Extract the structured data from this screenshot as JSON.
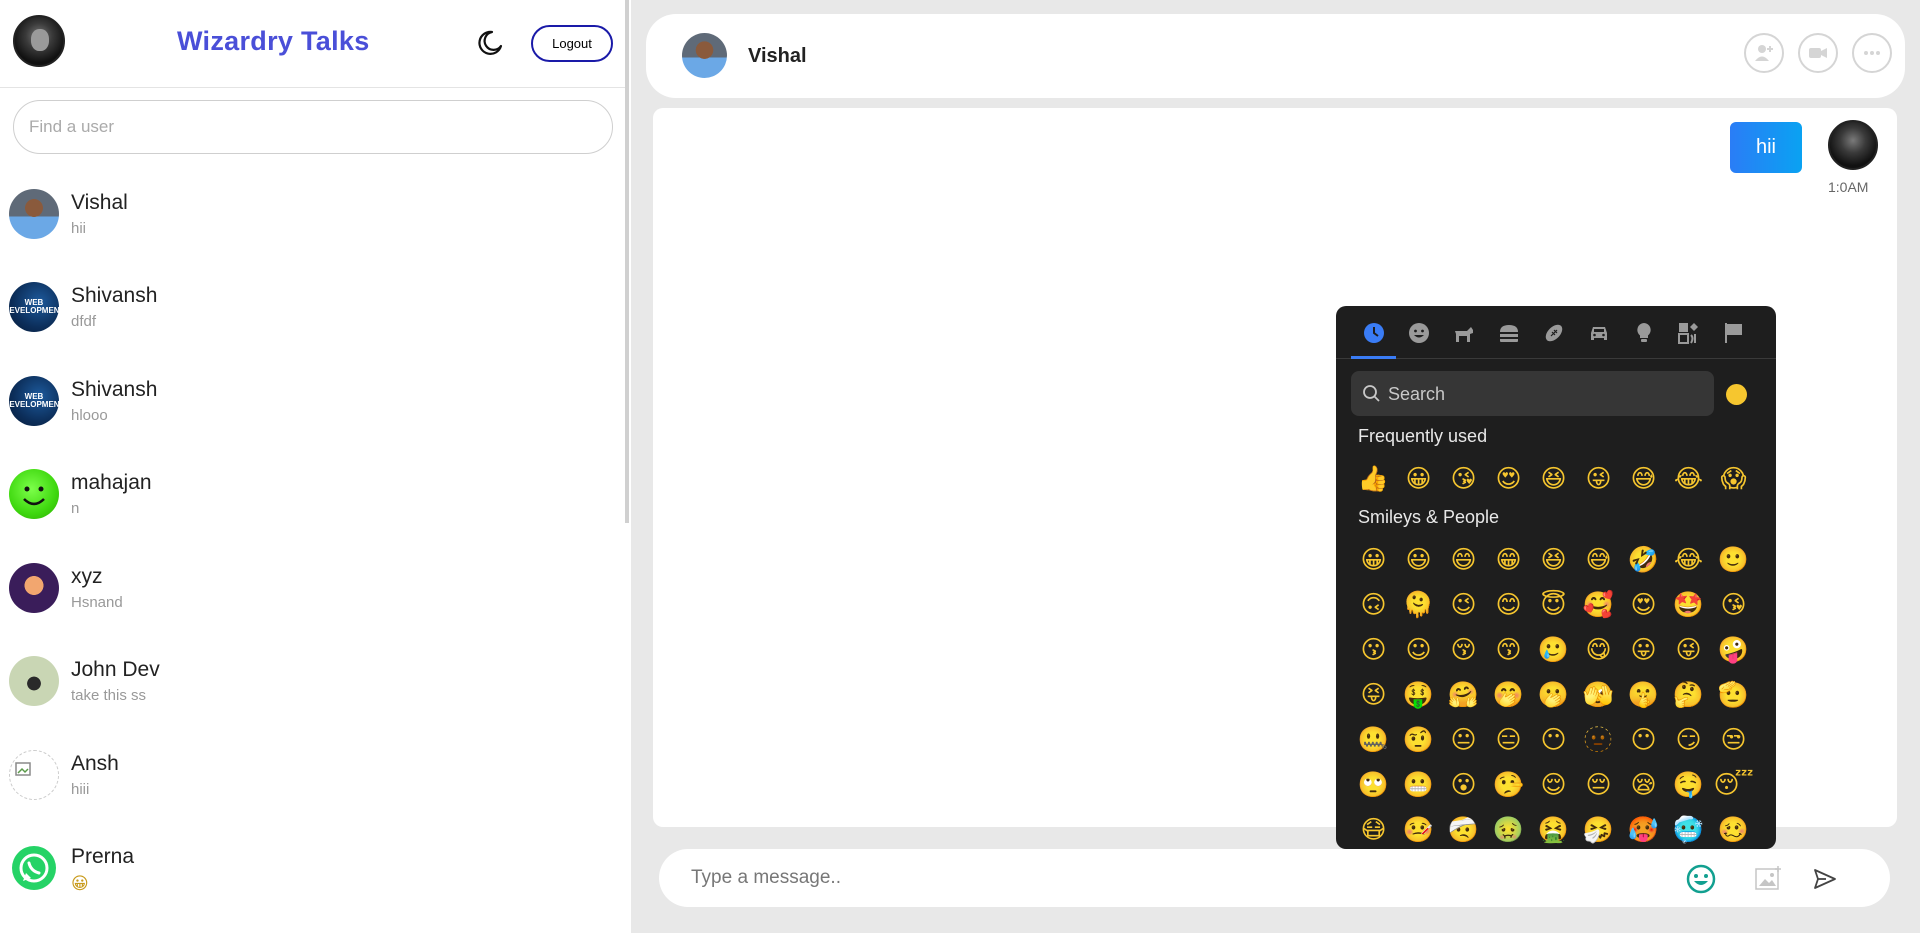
{
  "app": {
    "title": "Wizardry Talks",
    "logout_label": "Logout",
    "search_placeholder": "Find a user"
  },
  "users": [
    {
      "name": "Vishal",
      "last_message": "hii"
    },
    {
      "name": "Shivansh",
      "last_message": "dfdf",
      "avatar_text": "WEB DEVELOPMENT"
    },
    {
      "name": "Shivansh",
      "last_message": "hlooo",
      "avatar_text": "WEB DEVELOPMENT"
    },
    {
      "name": "mahajan",
      "last_message": "n"
    },
    {
      "name": "xyz",
      "last_message": "Hsnand"
    },
    {
      "name": "John Dev",
      "last_message": "take this ss"
    },
    {
      "name": "Ansh",
      "last_message": "hiii"
    },
    {
      "name": "Prerna",
      "last_message": "😀"
    }
  ],
  "chat": {
    "contact_name": "Vishal",
    "messages": [
      {
        "text": "hii",
        "time": "1:0AM",
        "outgoing": true
      }
    ],
    "input_placeholder": "Type a message.."
  },
  "emoji_picker": {
    "search_placeholder": "Search",
    "frequently_used_label": "Frequently used",
    "smileys_label": "Smileys & People",
    "categories": [
      "recent-icon",
      "smiley-icon",
      "animal-icon",
      "food-icon",
      "sports-icon",
      "travel-icon",
      "objects-icon",
      "symbols-icon",
      "flags-icon"
    ],
    "frequently_used": [
      "👍",
      "😀",
      "😘",
      "😍",
      "😆",
      "😜",
      "😅",
      "😂",
      "😱"
    ],
    "smileys": [
      "😀",
      "😃",
      "😄",
      "😁",
      "😆",
      "😅",
      "🤣",
      "😂",
      "🙂",
      "🙃",
      "🫠",
      "😉",
      "😊",
      "😇",
      "🥰",
      "😍",
      "🤩",
      "😘",
      "😗",
      "☺",
      "😚",
      "😙",
      "🥲",
      "😋",
      "😛",
      "😜",
      "🤪",
      "😝",
      "🤑",
      "🤗",
      "🤭",
      "🫢",
      "🫣",
      "🤫",
      "🤔",
      "🫡",
      "🤐",
      "🤨",
      "😐",
      "😑",
      "😶",
      "🫥",
      "😶",
      "😏",
      "😒",
      "🙄",
      "😬",
      "😮",
      "🤥",
      "😌",
      "😔",
      "😪",
      "🤤",
      "😴",
      "😷",
      "🤒",
      "🤕",
      "🤢",
      "🤮",
      "🤧",
      "🥵",
      "🥶",
      "🥴"
    ]
  },
  "colors": {
    "title": "#4a4fd8",
    "bubble": "#1a8ef4",
    "picker_bg": "#1e1e1e",
    "accent": "#3a7cf5"
  }
}
